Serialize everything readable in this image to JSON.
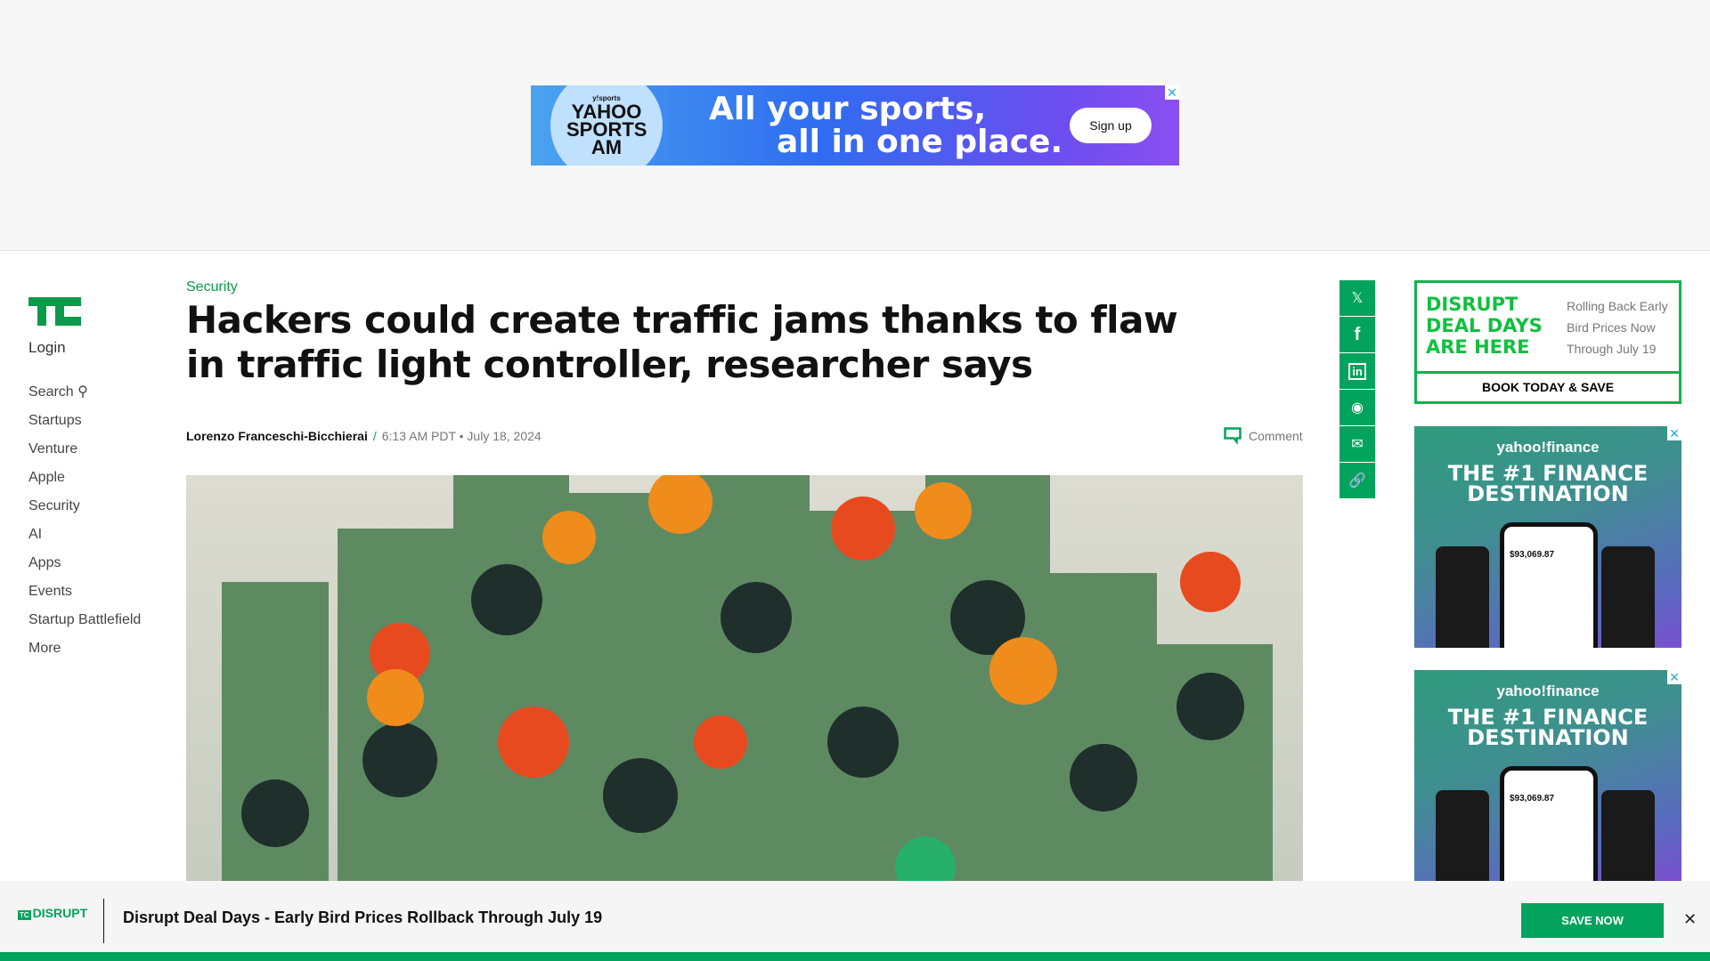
{
  "top_ad": {
    "brand_small": "y!sports",
    "brand": "YAHOO SPORTS AM",
    "headline_1": "All your sports,",
    "headline_2": "all in one place.",
    "cta": "Sign up",
    "close": "✕"
  },
  "sidebar": {
    "login": "Login",
    "items": [
      {
        "label": "Search"
      },
      {
        "label": "Startups"
      },
      {
        "label": "Venture"
      },
      {
        "label": "Apple"
      },
      {
        "label": "Security"
      },
      {
        "label": "AI"
      },
      {
        "label": "Apps"
      },
      {
        "label": "Events"
      },
      {
        "label": "Startup Battlefield"
      },
      {
        "label": "More"
      }
    ]
  },
  "article": {
    "category": "Security",
    "title": "Hackers could create traffic jams thanks to flaw in traffic light controller, researcher says",
    "author": "Lorenzo Franceschi-Bicchierai",
    "separator": "/",
    "timestamp": "6:13 AM PDT • July 18, 2024",
    "comment_label": "Comment"
  },
  "share": [
    "x-icon",
    "facebook-icon",
    "linkedin-icon",
    "reddit-icon",
    "email-icon",
    "link-icon"
  ],
  "disrupt_ad": {
    "headline": [
      "DISRUPT",
      "DEAL DAYS",
      "ARE HERE"
    ],
    "lines": [
      "Rolling Back Early",
      "Bird Prices Now",
      "Through July 19"
    ],
    "cta": "BOOK TODAY & SAVE"
  },
  "finance_ads": [
    {
      "brand": "yahoo!finance",
      "tag_1": "THE #1 FINANCE",
      "tag_2": "DESTINATION",
      "amount": "$93,069.87",
      "close": "✕"
    },
    {
      "brand": "yahoo!finance",
      "tag_1": "THE #1 FINANCE",
      "tag_2": "DESTINATION",
      "amount": "$93,069.87",
      "close": "✕"
    }
  ],
  "bottom_bar": {
    "logo": "DISRUPT",
    "message": "Disrupt Deal Days - Early Bird Prices Rollback Through July 19",
    "cta": "SAVE NOW",
    "close": "✕"
  },
  "colors": {
    "brand_green": "#02a35c",
    "link_green": "#0a9a4a"
  }
}
